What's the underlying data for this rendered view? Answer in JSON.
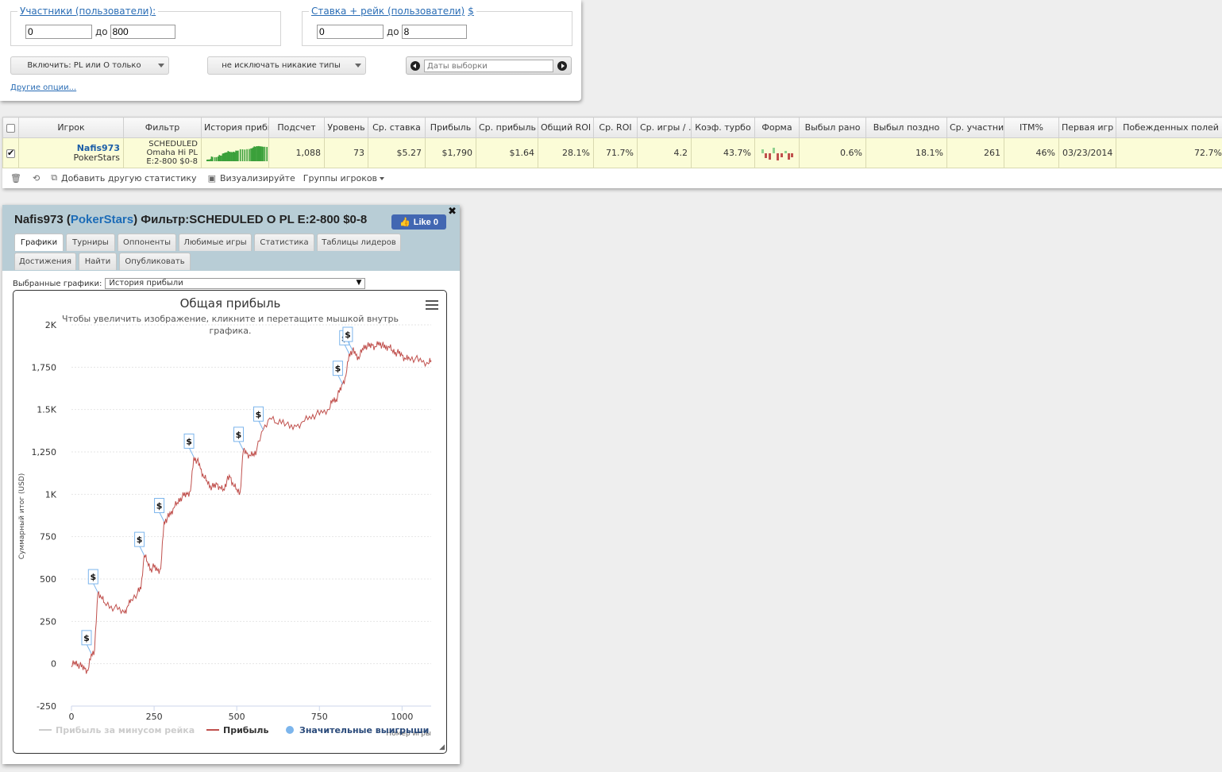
{
  "filters": {
    "participants_legend": "Участники (пользователи):",
    "participants_from": "0",
    "participants_to": "800",
    "stake_legend": "Ставка + рейк (пользователи)",
    "stake_legend_suffix": "$",
    "stake_from": "0",
    "stake_to": "8",
    "to_label": "до",
    "include_dropdown": "Включить: PL или O только",
    "exclude_dropdown": "не исключать никакие типы",
    "dates_placeholder": "Даты выборки",
    "other_options": "Другие опции..."
  },
  "table": {
    "headers": [
      "Игрок",
      "Фильтр",
      "История прибы",
      "Подсчет",
      "Уровень",
      "Ср. ставка",
      "Прибыль",
      "Ср. прибыль",
      "Общий ROI",
      "Ср. ROI",
      "Ср. игры / .",
      "Коэф. турбо",
      "Форма",
      "Выбыл рано",
      "Выбыл поздно",
      "Ср. участни",
      "ITM%",
      "Первая игр",
      "Побежденных полей"
    ],
    "row": {
      "player_name": "Nafis973",
      "site": "PokerStars",
      "filter_line1": "SCHEDULED",
      "filter_line2": "Omaha Hi PL",
      "filter_line3": "E:2-800 $0-8",
      "count": "1,088",
      "level": "73",
      "avg_stake": "$5.27",
      "profit": "$1,790",
      "avg_profit": "$1.64",
      "total_roi": "28.1%",
      "avg_roi": "71.7%",
      "avg_games": "4.2",
      "turbo": "43.7%",
      "early_out": "0.6%",
      "late_out": "18.1%",
      "avg_entrants": "261",
      "itm": "46%",
      "first_game": "03/23/2014",
      "fields_beaten": "72.7%"
    },
    "toolbar": {
      "trash_icon": "trash-icon",
      "refresh_icon": "refresh-icon",
      "add_stat": "Добавить другую статистику",
      "visualize": "Визуализируйте",
      "groups": "Группы игроков"
    }
  },
  "profile": {
    "name": "Nafis973",
    "site": "PokerStars",
    "filter_label": "Фильтр:",
    "filter_value": "SCHEDULED O PL E:2-800 $0-8",
    "like_label": "Like 0",
    "tabs": [
      "Графики",
      "Турниры",
      "Оппоненты",
      "Любимые игры",
      "Статистика",
      "Таблицы лидеров",
      "Достижения",
      "Найти",
      "Опубликовать"
    ],
    "selected_charts_label": "Выбранные графики:",
    "selected_chart": "История прибыли"
  },
  "colors": {
    "profit_line": "#c0504d",
    "rake_line": "#cccccc",
    "big_wins": "#7cb5ec",
    "accent": "#1d6cb7",
    "row_highlight": "#fbfcd7"
  },
  "chart_data": {
    "type": "line",
    "title": "Общая прибыль",
    "subtitle": "Чтобы увеличить изображение, кликните и перетащите мышкой внутрь графика.",
    "xlabel": "Номер игры",
    "ylabel": "Суммарный итог (USD)",
    "xlim": [
      0,
      1088
    ],
    "ylim": [
      -250,
      2000
    ],
    "x_ticks": [
      "0",
      "250",
      "500",
      "750",
      "1000"
    ],
    "y_ticks": [
      "-250",
      "0",
      "250",
      "500",
      "750",
      "1K",
      "1,250",
      "1.5K",
      "1,750",
      "2K"
    ],
    "legend": [
      "Прибыль за минусом рейка",
      "Прибыль",
      "Значительные выигрыши"
    ],
    "legend_position": "bottom",
    "flag_label": "$",
    "series": [
      {
        "name": "Прибыль",
        "points": [
          [
            0,
            -20
          ],
          [
            10,
            10
          ],
          [
            20,
            0
          ],
          [
            30,
            -20
          ],
          [
            40,
            -30
          ],
          [
            50,
            -40
          ],
          [
            60,
            60
          ],
          [
            70,
            80
          ],
          [
            80,
            420
          ],
          [
            90,
            390
          ],
          [
            100,
            360
          ],
          [
            120,
            340
          ],
          [
            140,
            320
          ],
          [
            160,
            300
          ],
          [
            170,
            340
          ],
          [
            180,
            380
          ],
          [
            200,
            420
          ],
          [
            210,
            440
          ],
          [
            220,
            640
          ],
          [
            230,
            600
          ],
          [
            240,
            560
          ],
          [
            250,
            570
          ],
          [
            260,
            550
          ],
          [
            270,
            560
          ],
          [
            280,
            840
          ],
          [
            290,
            860
          ],
          [
            300,
            880
          ],
          [
            310,
            920
          ],
          [
            320,
            950
          ],
          [
            330,
            980
          ],
          [
            340,
            990
          ],
          [
            350,
            1000
          ],
          [
            360,
            1020
          ],
          [
            370,
            1220
          ],
          [
            380,
            1200
          ],
          [
            390,
            1150
          ],
          [
            400,
            1100
          ],
          [
            410,
            1080
          ],
          [
            420,
            1050
          ],
          [
            430,
            1040
          ],
          [
            440,
            1060
          ],
          [
            450,
            1040
          ],
          [
            460,
            1030
          ],
          [
            470,
            1080
          ],
          [
            480,
            1100
          ],
          [
            490,
            1050
          ],
          [
            500,
            1030
          ],
          [
            510,
            1010
          ],
          [
            520,
            1260
          ],
          [
            530,
            1240
          ],
          [
            540,
            1230
          ],
          [
            550,
            1240
          ],
          [
            560,
            1260
          ],
          [
            580,
            1380
          ],
          [
            600,
            1450
          ],
          [
            620,
            1420
          ],
          [
            640,
            1440
          ],
          [
            660,
            1390
          ],
          [
            680,
            1400
          ],
          [
            700,
            1430
          ],
          [
            720,
            1460
          ],
          [
            740,
            1470
          ],
          [
            760,
            1480
          ],
          [
            780,
            1500
          ],
          [
            790,
            1560
          ],
          [
            800,
            1560
          ],
          [
            810,
            1600
          ],
          [
            820,
            1650
          ],
          [
            830,
            1700
          ],
          [
            840,
            1830
          ],
          [
            850,
            1850
          ],
          [
            860,
            1820
          ],
          [
            870,
            1800
          ],
          [
            880,
            1860
          ],
          [
            890,
            1880
          ],
          [
            900,
            1870
          ],
          [
            910,
            1880
          ],
          [
            920,
            1870
          ],
          [
            930,
            1900
          ],
          [
            940,
            1880
          ],
          [
            950,
            1860
          ],
          [
            960,
            1870
          ],
          [
            970,
            1850
          ],
          [
            980,
            1840
          ],
          [
            990,
            1830
          ],
          [
            1000,
            1820
          ],
          [
            1010,
            1800
          ],
          [
            1020,
            1810
          ],
          [
            1040,
            1800
          ],
          [
            1060,
            1780
          ],
          [
            1080,
            1770
          ],
          [
            1088,
            1790
          ]
        ]
      },
      {
        "name": "Значительные выигрыши",
        "points": [
          [
            60,
            60
          ],
          [
            80,
            420
          ],
          [
            220,
            640
          ],
          [
            280,
            840
          ],
          [
            370,
            1220
          ],
          [
            520,
            1260
          ],
          [
            580,
            1380
          ],
          [
            820,
            1650
          ],
          [
            840,
            1830
          ],
          [
            850,
            1850
          ]
        ]
      }
    ]
  }
}
